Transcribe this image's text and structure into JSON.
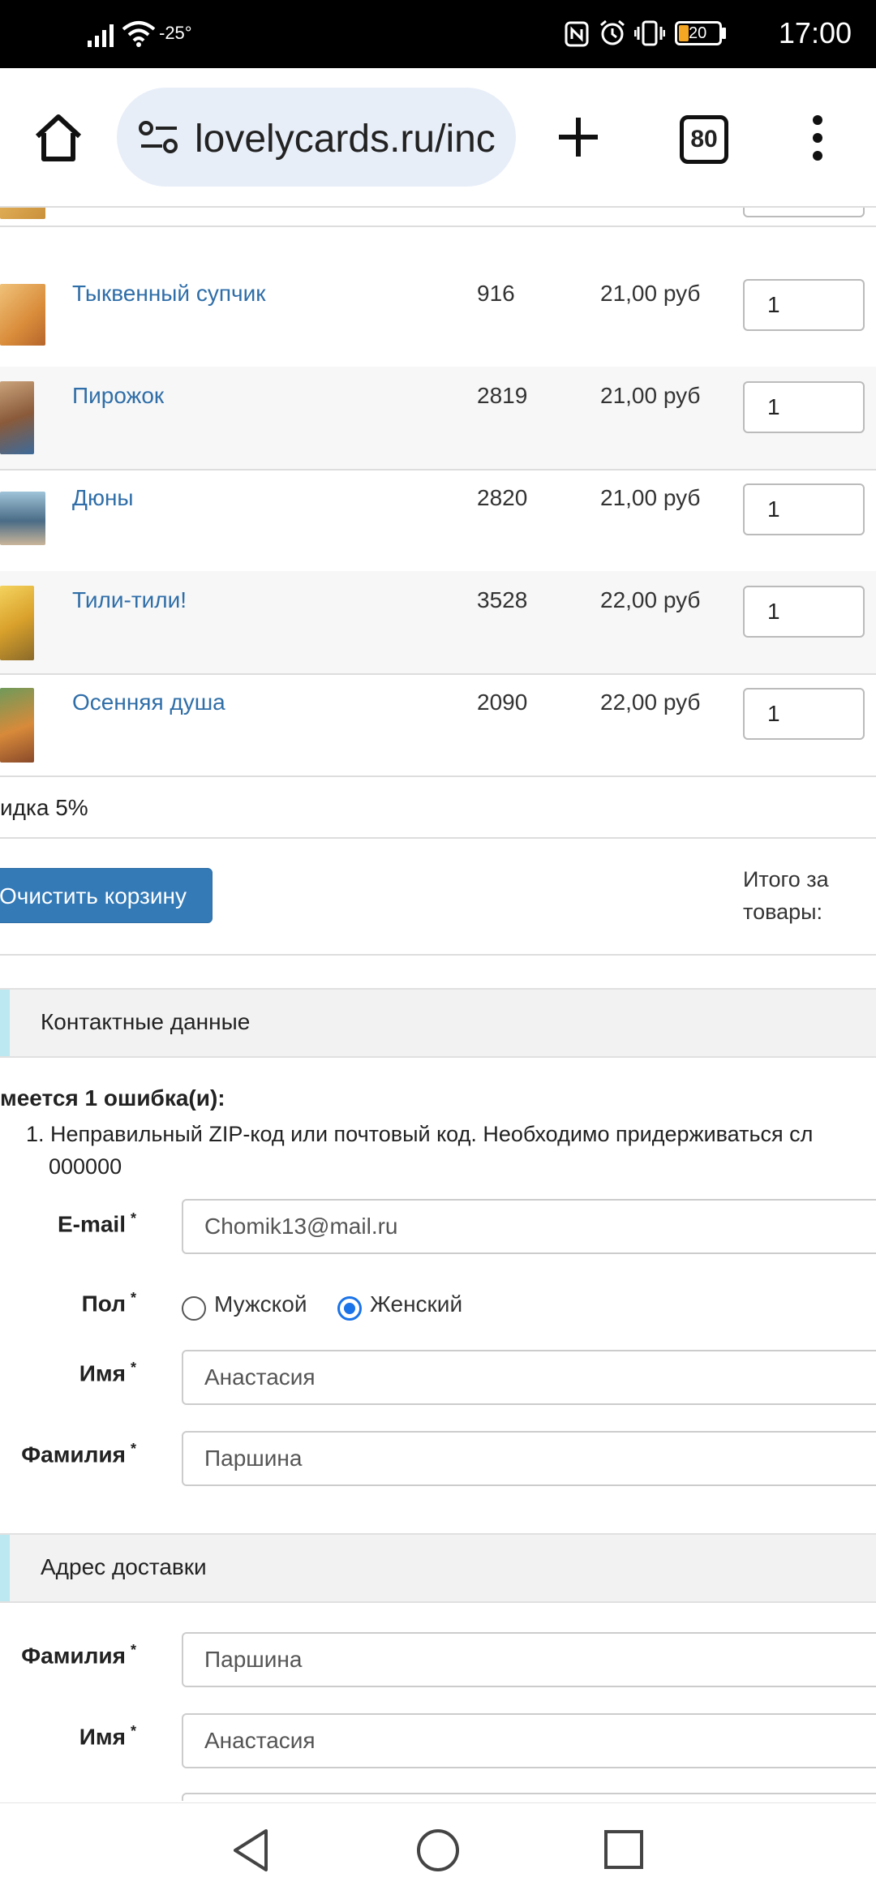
{
  "status_bar": {
    "time": "17:00",
    "temperature": "-25°",
    "battery": "20"
  },
  "browser": {
    "url": "lovelycards.ru/inc",
    "tab_count": "80"
  },
  "cart": {
    "rows": [
      {
        "name": "Тыквенный супчик",
        "code": "916",
        "price": "21,00 руб",
        "qty": "1"
      },
      {
        "name": "Пирожок",
        "code": "2819",
        "price": "21,00 руб",
        "qty": "1"
      },
      {
        "name": "Дюны",
        "code": "2820",
        "price": "21,00 руб",
        "qty": "1"
      },
      {
        "name": "Тили-тили!",
        "code": "3528",
        "price": "22,00 руб",
        "qty": "1"
      },
      {
        "name": "Осенняя душа",
        "code": "2090",
        "price": "22,00 руб",
        "qty": "1"
      }
    ],
    "discount": "идка 5%",
    "clear_button": "Очистить корзину",
    "total_label_1": "Итого за",
    "total_label_2": "товары:"
  },
  "contact": {
    "section_title": "Контактные данные",
    "error_head": "меется 1 ошибка(и):",
    "error_line1": "1. Неправильный ZIP-код или почтовый код. Необходимо придерживаться сл",
    "error_line2": "000000",
    "email_label": "E-mail",
    "email_value": "Chomik13@mail.ru",
    "gender_label": "Пол",
    "gender_male": "Мужской",
    "gender_female": "Женский",
    "first_name_label": "Имя",
    "first_name_value": "Анастасия",
    "last_name_label": "Фамилия",
    "last_name_value": "Паршина",
    "required_mark": "*"
  },
  "shipping": {
    "section_title": "Адрес доставки",
    "last_name_label": "Фамилия",
    "last_name_value": "Паршина",
    "first_name_label": "Имя",
    "first_name_value": "Анастасия",
    "required_mark": "*"
  }
}
